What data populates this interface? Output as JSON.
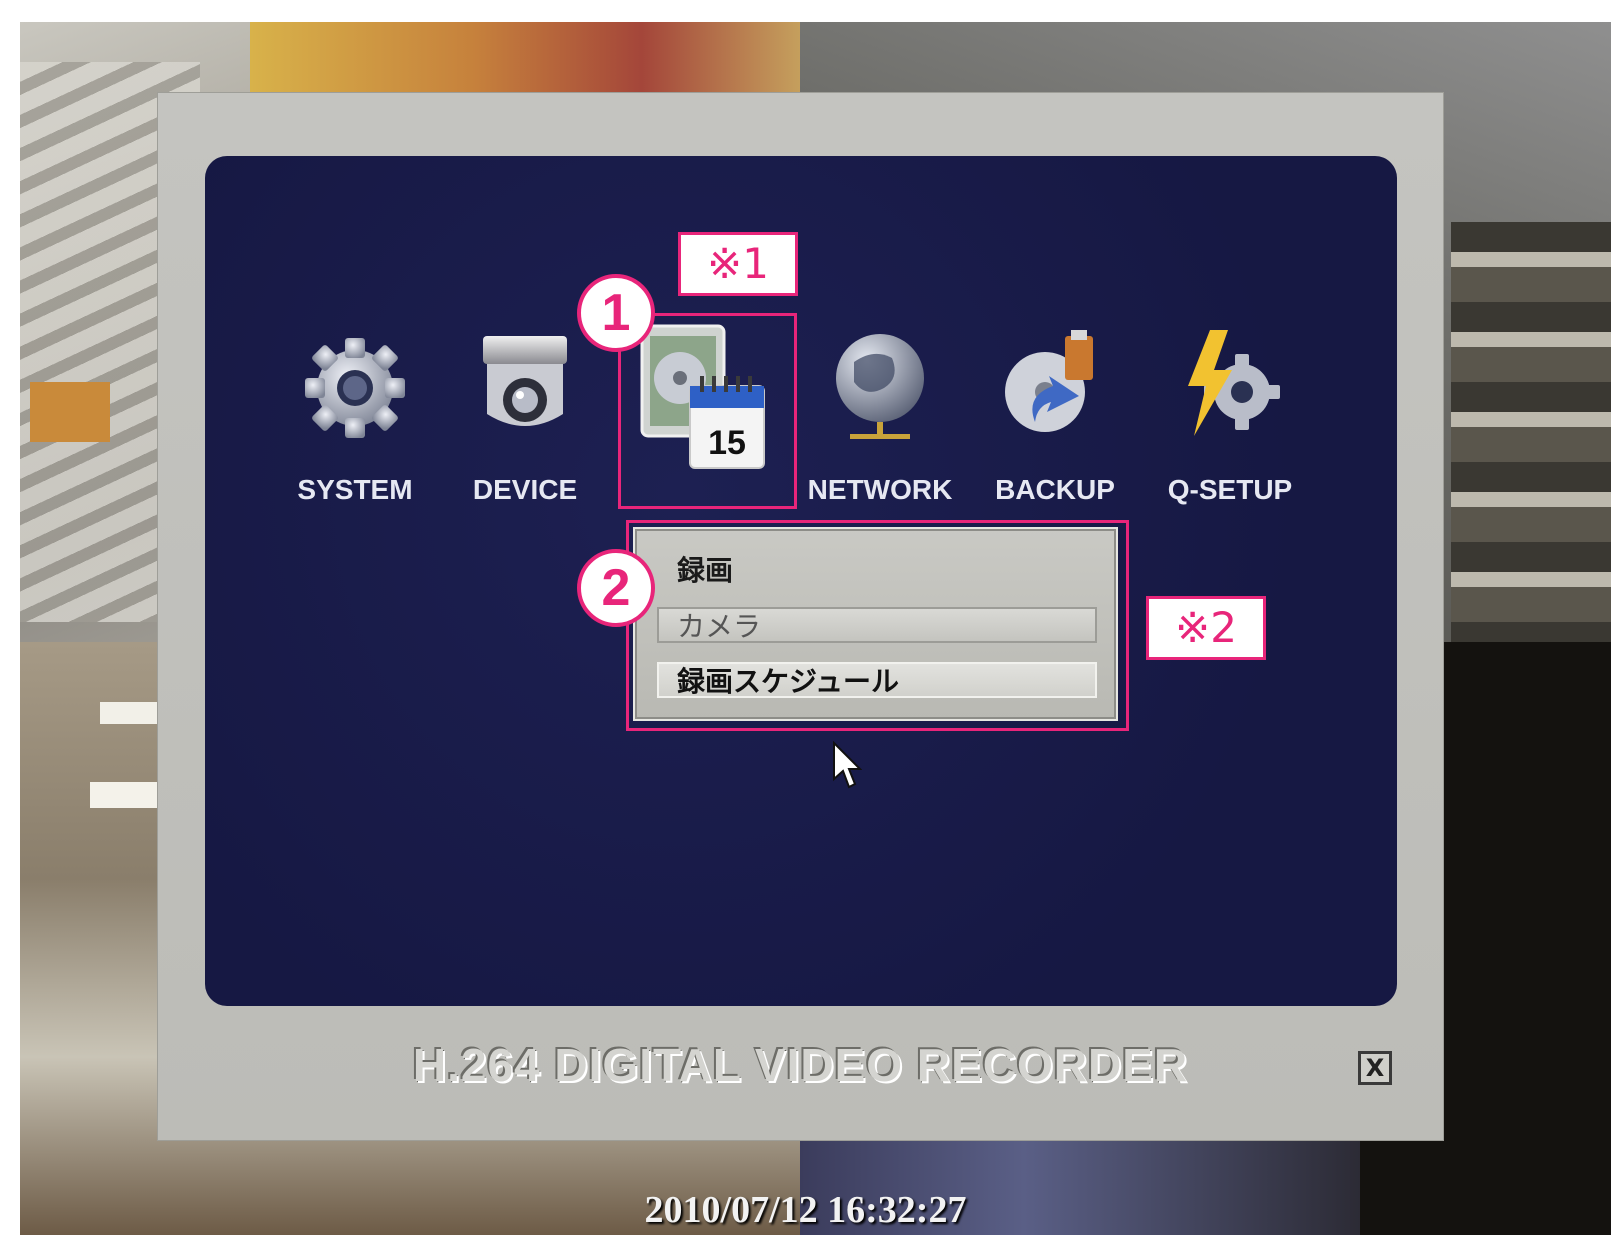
{
  "menu": {
    "items": [
      {
        "label": "SYSTEM",
        "icon": "gear-icon"
      },
      {
        "label": "DEVICE",
        "icon": "camera-icon"
      },
      {
        "label": "",
        "icon": "record-calendar-icon",
        "calendar_day": "15"
      },
      {
        "label": "NETWORK",
        "icon": "globe-icon"
      },
      {
        "label": "BACKUP",
        "icon": "backup-disc-icon"
      },
      {
        "label": "Q-SETUP",
        "icon": "quick-setup-icon"
      }
    ]
  },
  "annotations": {
    "note1": "※1",
    "note2": "※2",
    "step1": "1",
    "step2": "2",
    "accent_color": "#e8257a"
  },
  "submenu": {
    "title": "録画",
    "options": [
      "カメラ",
      "録画スケジュール"
    ],
    "highlighted": "録画スケジュール"
  },
  "footer": {
    "brand": "H.264 DIGITAL VIDEO RECORDER",
    "close_glyph": "X"
  },
  "timestamp": "2010/07/12 16:32:27"
}
